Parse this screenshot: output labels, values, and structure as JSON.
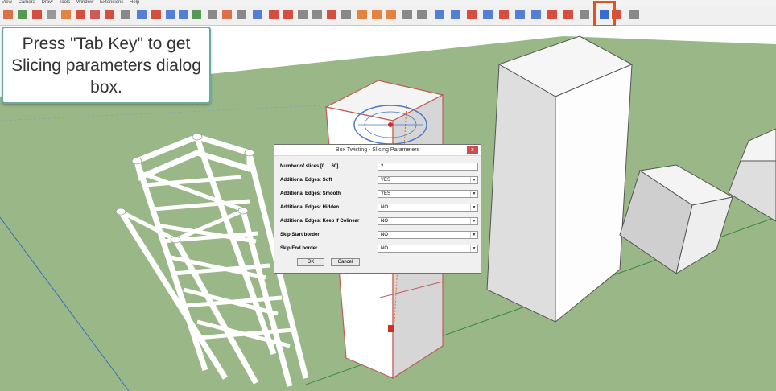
{
  "menubar": {
    "items": [
      "View",
      "Camera",
      "Draw",
      "Tools",
      "Window",
      "Extensions",
      "Help"
    ]
  },
  "callout": {
    "text": "Press \"Tab Key\" to get Slicing parameters dialog box."
  },
  "dialog": {
    "title": "Box Twisting - Slicing Parameters",
    "close": "x",
    "rows": [
      {
        "label": "Number of slices  [0 ... 60]",
        "value": "2",
        "dropdown": false
      },
      {
        "label": "Additional Edges: Soft",
        "value": "YES",
        "dropdown": true
      },
      {
        "label": "Additional Edges: Smooth",
        "value": "YES",
        "dropdown": true
      },
      {
        "label": "Additional Edges: Hidden",
        "value": "NO",
        "dropdown": true
      },
      {
        "label": "Additional Edges: Keep if Colinear",
        "value": "NO",
        "dropdown": true
      },
      {
        "label": "Skip Start border",
        "value": "NO",
        "dropdown": true
      },
      {
        "label": "Skip End border",
        "value": "NO",
        "dropdown": true
      }
    ],
    "ok": "OK",
    "cancel": "Cancel"
  },
  "colors": {
    "sky": "#ffffff",
    "ground": "#9ab887",
    "highlight": "#e0521f",
    "callout_border": "#6fa7a3"
  }
}
